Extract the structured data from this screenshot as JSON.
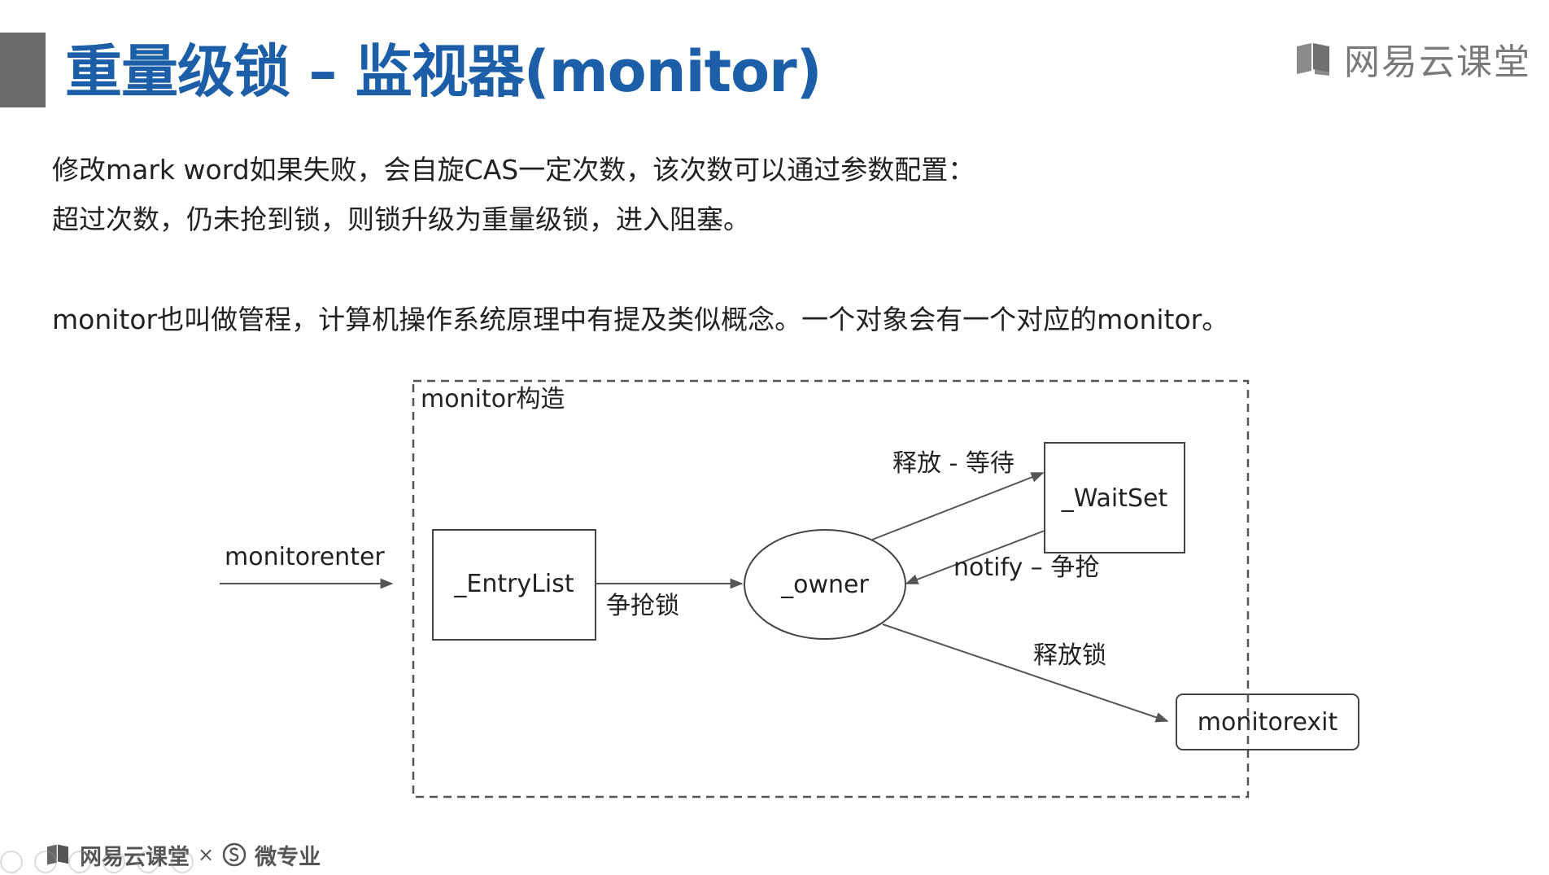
{
  "slide": {
    "title": "重量级锁 – 监视器(monitor)",
    "brand": "网易云课堂",
    "line1": "修改mark word如果失败，会自旋CAS一定次数，该次数可以通过参数配置：",
    "line2": "超过次数，仍未抢到锁，则锁升级为重量级锁，进入阻塞。",
    "line3": "monitor也叫做管程，计算机操作系统原理中有提及类似概念。一个对象会有一个对应的monitor。"
  },
  "diagram": {
    "container_label": "monitor构造",
    "monitorenter": "monitorenter",
    "entrylist": "_EntryList",
    "compete_lock": "争抢锁",
    "owner": "_owner",
    "release_wait": "释放 - 等待",
    "waitset": "_WaitSet",
    "notify_compete": "notify – 争抢",
    "release_lock": "释放锁",
    "monitorexit": "monitorexit"
  },
  "footer": {
    "brand": "网易云课堂",
    "x": "×",
    "partner": "微专业"
  },
  "colors": {
    "title": "#1c5fa8",
    "title_bar": "#6b6b6b",
    "brand_gray": "#7a7a7a",
    "line": "#555555"
  },
  "icons": {
    "brand_logo": "book-icon",
    "partner_logo": "s-circle-icon"
  }
}
